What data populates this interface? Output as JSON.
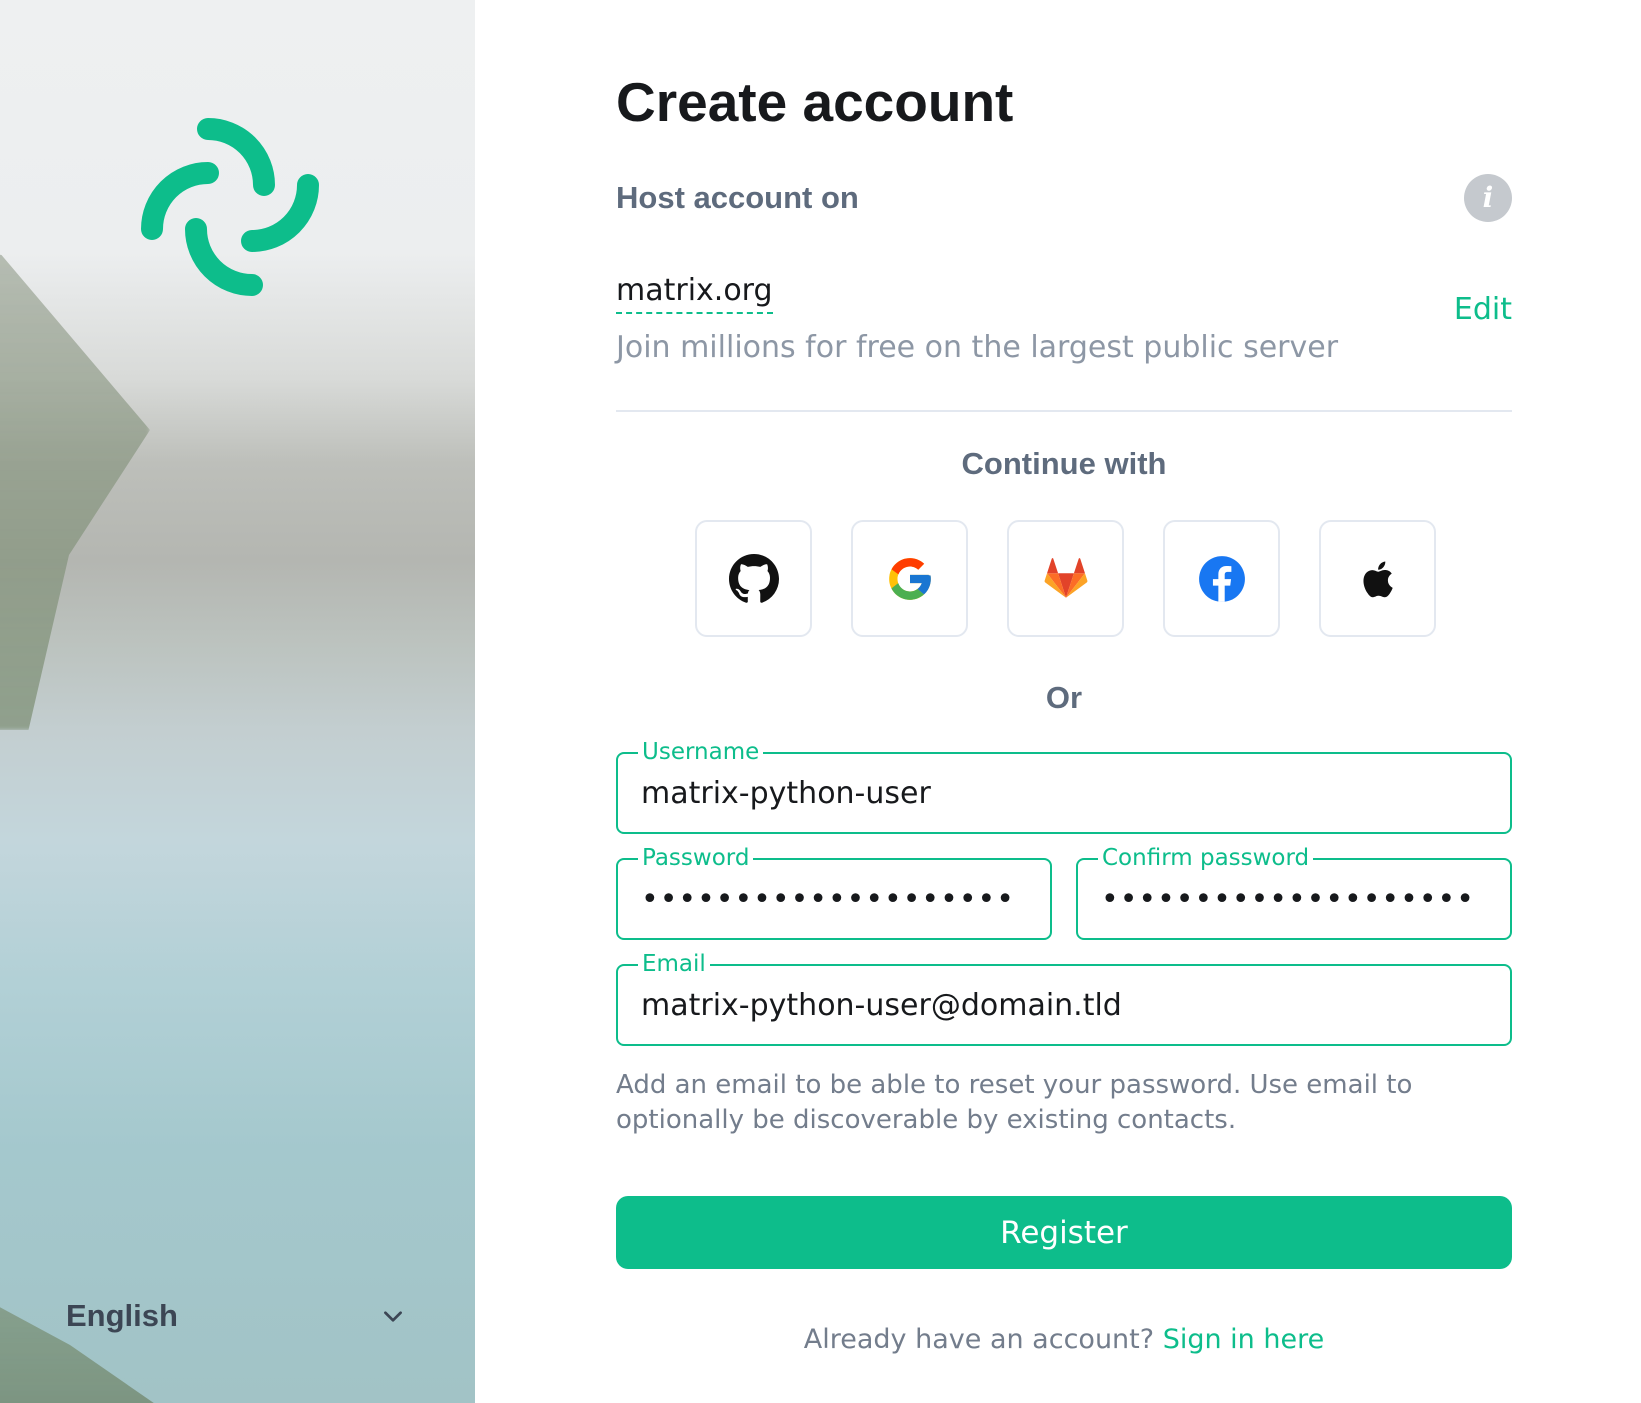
{
  "brand": {
    "logo_icon": "element-logo-icon",
    "accent_color": "#0dbd8b"
  },
  "language": {
    "selected": "English",
    "icon": "chevron-down-icon"
  },
  "form": {
    "title": "Create account",
    "host_label": "Host account on",
    "info_icon": "info-icon",
    "server_name": "matrix.org",
    "edit_label": "Edit",
    "server_description": "Join millions for free on the largest public server",
    "continue_with": "Continue with",
    "sso_providers": [
      {
        "name": "GitHub",
        "icon": "github-icon"
      },
      {
        "name": "Google",
        "icon": "google-icon"
      },
      {
        "name": "GitLab",
        "icon": "gitlab-icon"
      },
      {
        "name": "Facebook",
        "icon": "facebook-icon"
      },
      {
        "name": "Apple",
        "icon": "apple-icon"
      }
    ],
    "or_label": "Or",
    "username": {
      "label": "Username",
      "value": "matrix-python-user"
    },
    "password": {
      "label": "Password",
      "value": "••••••••••••••••••••"
    },
    "confirm_password": {
      "label": "Confirm password",
      "value": "••••••••••••••••••••"
    },
    "email": {
      "label": "Email",
      "value": "matrix-python-user@domain.tld"
    },
    "email_help": "Add an email to be able to reset your password. Use email to optionally be discoverable by existing contacts.",
    "register_label": "Register",
    "signin_prompt": "Already have an account?",
    "signin_link": "Sign in here"
  }
}
